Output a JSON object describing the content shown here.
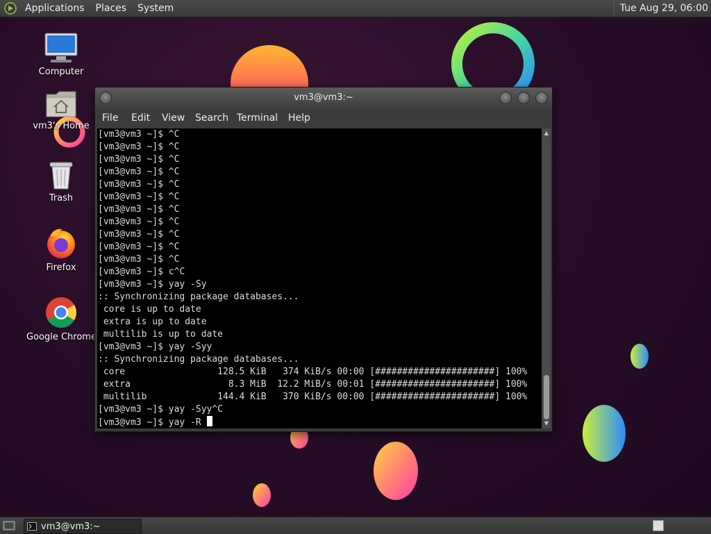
{
  "top_panel": {
    "menus": [
      "Applications",
      "Places",
      "System"
    ],
    "clock": "Tue Aug 29, 06:00"
  },
  "desktop": {
    "icons": [
      {
        "label": "Computer",
        "icon": "computer-icon"
      },
      {
        "label": "vm3's Home",
        "icon": "home-folder-icon"
      },
      {
        "label": "Trash",
        "icon": "trash-icon"
      },
      {
        "label": "Firefox",
        "icon": "firefox-icon"
      },
      {
        "label": "Google Chrome",
        "icon": "chrome-icon"
      }
    ]
  },
  "terminal": {
    "title": "vm3@vm3:~",
    "menus": [
      "File",
      "Edit",
      "View",
      "Search",
      "Terminal",
      "Help"
    ],
    "lines": [
      "[vm3@vm3 ~]$ ^C",
      "[vm3@vm3 ~]$ ^C",
      "[vm3@vm3 ~]$ ^C",
      "[vm3@vm3 ~]$ ^C",
      "[vm3@vm3 ~]$ ^C",
      "[vm3@vm3 ~]$ ^C",
      "[vm3@vm3 ~]$ ^C",
      "[vm3@vm3 ~]$ ^C",
      "[vm3@vm3 ~]$ ^C",
      "[vm3@vm3 ~]$ ^C",
      "[vm3@vm3 ~]$ ^C",
      "[vm3@vm3 ~]$ c^C",
      "[vm3@vm3 ~]$ yay -Sy",
      ":: Synchronizing package databases...",
      " core is up to date",
      " extra is up to date",
      " multilib is up to date",
      "[vm3@vm3 ~]$ yay -Syy",
      ":: Synchronizing package databases...",
      " core                 128.5 KiB   374 KiB/s 00:00 [######################] 100%",
      " extra                  8.3 MiB  12.2 MiB/s 00:01 [######################] 100%",
      " multilib             144.4 KiB   370 KiB/s 00:00 [######################] 100%",
      "[vm3@vm3 ~]$ yay -Syy^C"
    ],
    "current_prompt": "[vm3@vm3 ~]$ yay -R "
  },
  "taskbar": {
    "items": [
      {
        "label": "vm3@vm3:~"
      }
    ]
  }
}
